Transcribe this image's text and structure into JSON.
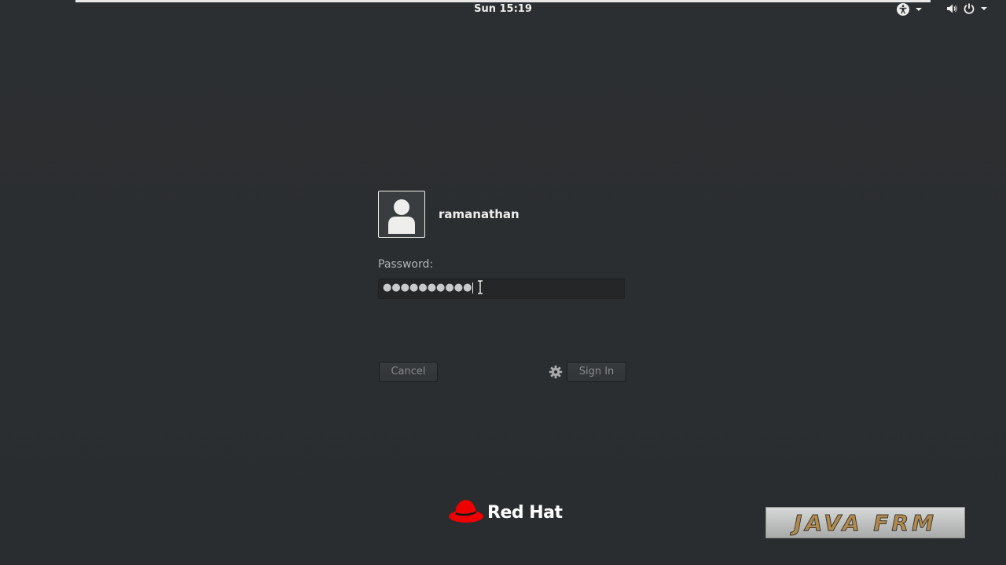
{
  "topbar": {
    "clock": "Sun 15:19"
  },
  "login": {
    "username": "ramanathan",
    "password_label": "Password:",
    "password_mask": "●●●●●●●●●●",
    "cancel_label": "Cancel",
    "signin_label": "Sign In"
  },
  "brand": {
    "text": "Red Hat",
    "hat_color": "#ee0000"
  },
  "watermark": {
    "text": "JAVA FRM"
  },
  "colors": {
    "background": "#2b2e30",
    "text": "#eeeeec",
    "button_text": "#888a8c"
  }
}
